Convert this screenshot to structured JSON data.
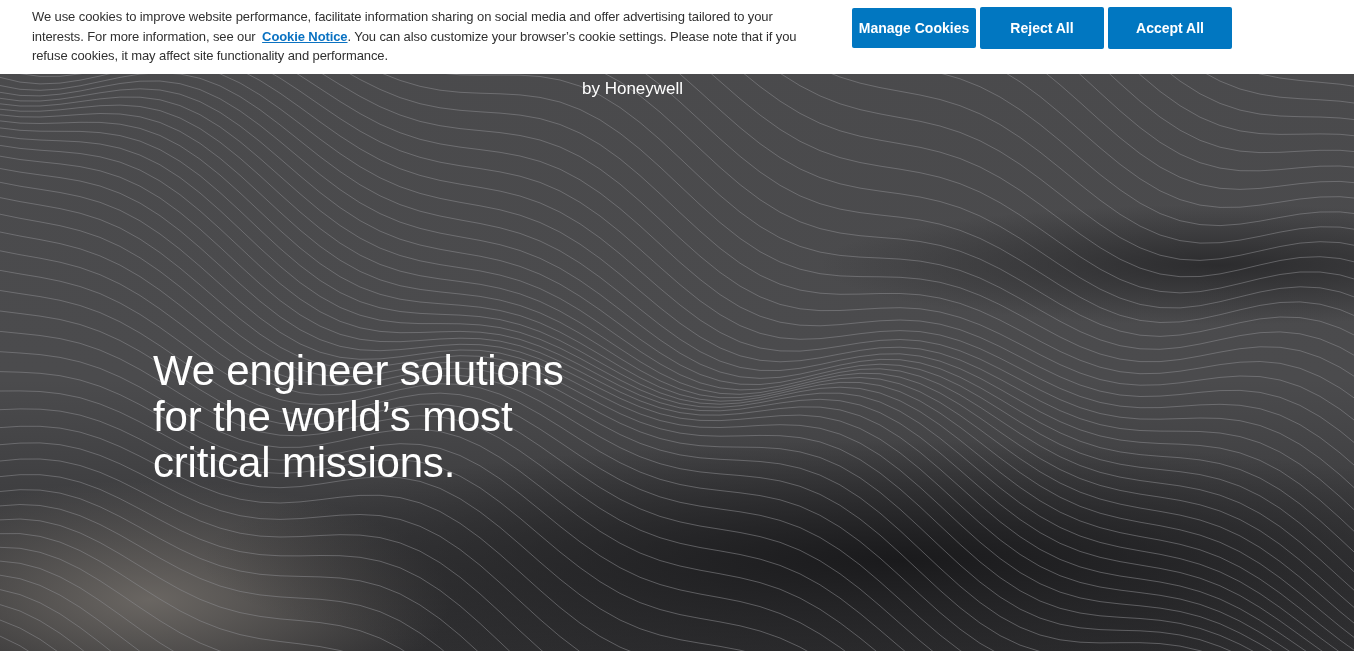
{
  "cookie_banner": {
    "message_before_link": "We use cookies to improve website performance, facilitate information sharing on social media and offer advertising tailored to your interests. For more information, see our ",
    "link": "Cookie Notice",
    "message_after_link": ". You can also customize your browser’s cookie settings. Please note that if you refuse cookies, it may affect site functionality and performance.",
    "buttons": [
      "Manage Cookies",
      "Reject All",
      "Accept All"
    ]
  },
  "hero": {
    "brand_tagline": "by Honeywell",
    "headline": [
      "We engineer solutions",
      "for the world’s most",
      "critical missions."
    ]
  }
}
